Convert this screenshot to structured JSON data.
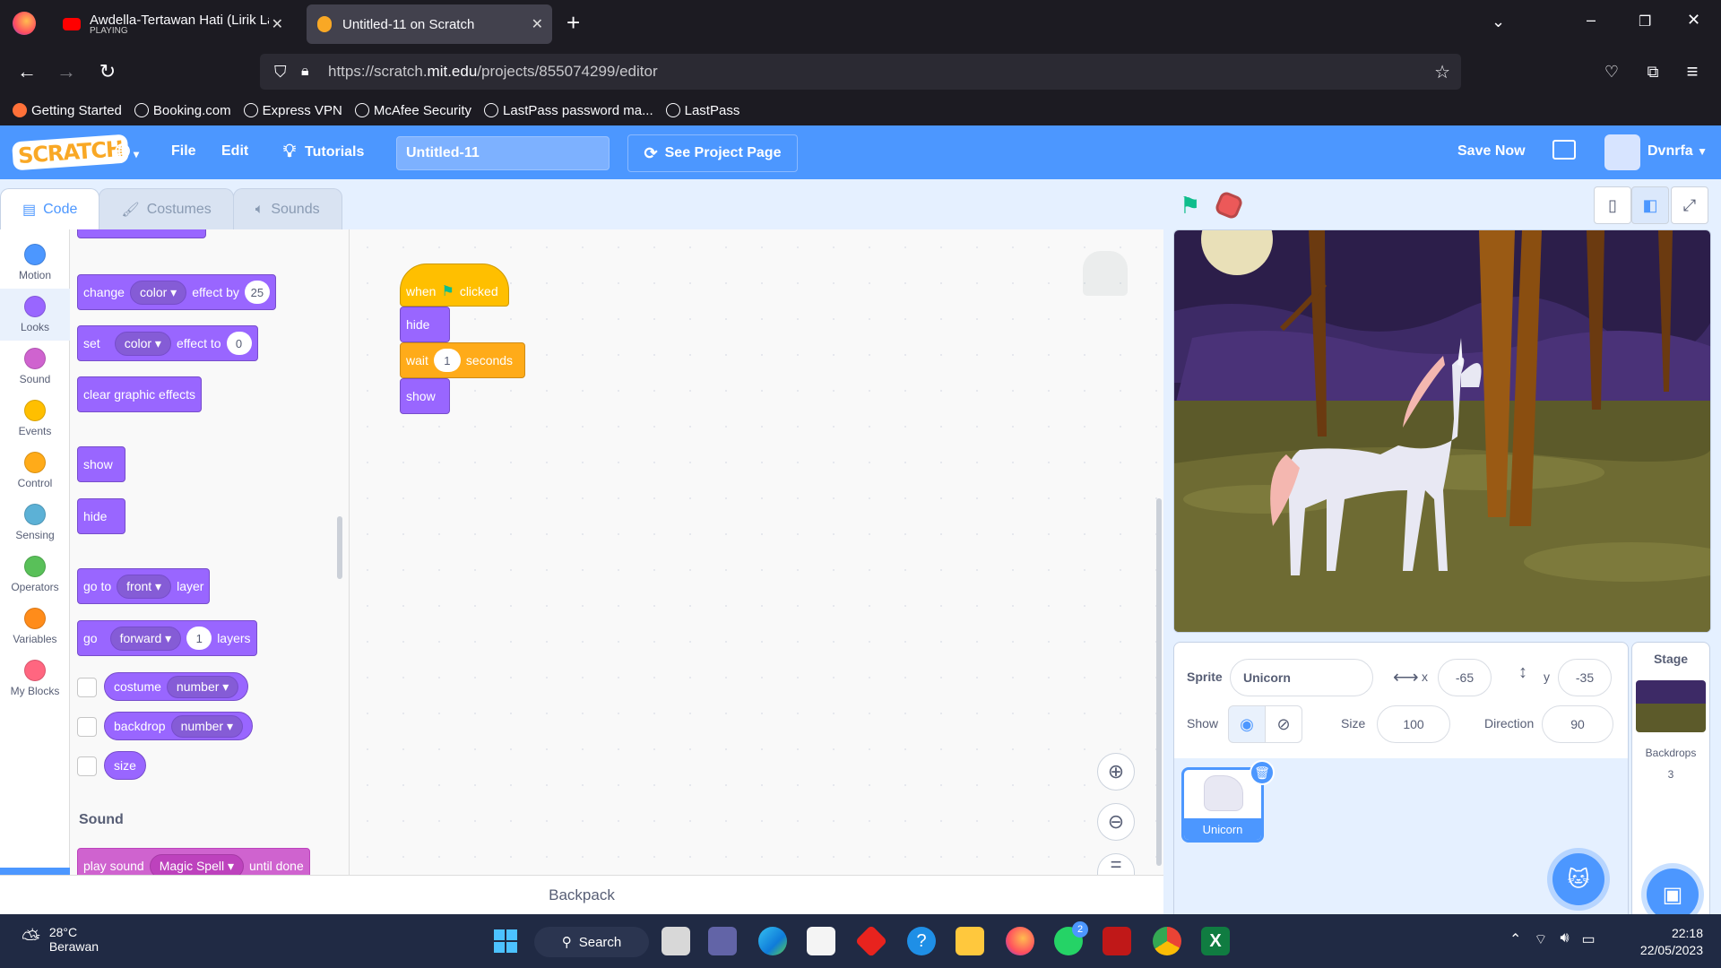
{
  "browser": {
    "tabs": [
      {
        "title": "Awdella-Tertawan Hati (Lirik La",
        "sub": "PLAYING"
      },
      {
        "title": "Untitled-11 on Scratch"
      }
    ],
    "url_prefix": "https://scratch.",
    "url_host": "mit.edu",
    "url_path": "/projects/855074299/editor",
    "bookmarks": [
      "Getting Started",
      "Booking.com",
      "Express VPN",
      "McAfee Security",
      "LastPass password ma...",
      "LastPass"
    ]
  },
  "menubar": {
    "logo": "SCRATCH",
    "file": "File",
    "edit": "Edit",
    "tutorials": "Tutorials",
    "project_title": "Untitled-11",
    "see_project": "See Project Page",
    "save_now": "Save Now",
    "username": "Dvnrfa"
  },
  "editor_tabs": [
    "Code",
    "Costumes",
    "Sounds"
  ],
  "categories": [
    {
      "label": "Motion",
      "color": "#4c97ff"
    },
    {
      "label": "Looks",
      "color": "#9966ff"
    },
    {
      "label": "Sound",
      "color": "#cf63cf"
    },
    {
      "label": "Events",
      "color": "#ffbf00"
    },
    {
      "label": "Control",
      "color": "#ffab19"
    },
    {
      "label": "Sensing",
      "color": "#5cb1d6"
    },
    {
      "label": "Operators",
      "color": "#59c059"
    },
    {
      "label": "Variables",
      "color": "#ff8c1a"
    },
    {
      "label": "My Blocks",
      "color": "#ff6680"
    }
  ],
  "palette": {
    "change_effect": {
      "a": "change",
      "dd": "color",
      "b": "effect by",
      "val": "25"
    },
    "set_effect": {
      "a": "set",
      "dd": "color",
      "b": "effect to",
      "val": "0"
    },
    "clear": "clear graphic effects",
    "show": "show",
    "hide": "hide",
    "goto_layer": {
      "a": "go to",
      "dd": "front",
      "b": "layer"
    },
    "go_layers": {
      "a": "go",
      "dd": "forward",
      "val": "1",
      "b": "layers"
    },
    "costume": {
      "a": "costume",
      "dd": "number"
    },
    "backdrop": {
      "a": "backdrop",
      "dd": "number"
    },
    "size": "size",
    "sound_title": "Sound",
    "play_sound": {
      "a": "play sound",
      "dd": "Magic Spell",
      "b": "until done"
    }
  },
  "script": {
    "when": "when",
    "clicked": "clicked",
    "hide": "hide",
    "wait": "wait",
    "wait_val": "1",
    "seconds": "seconds",
    "show": "show"
  },
  "backpack": "Backpack",
  "sprite_info": {
    "sprite_label": "Sprite",
    "sprite_name": "Unicorn",
    "x_label": "x",
    "x": "-65",
    "y_label": "y",
    "y": "-35",
    "show_label": "Show",
    "size_label": "Size",
    "size": "100",
    "direction_label": "Direction",
    "direction": "90"
  },
  "sprites": [
    {
      "name": "Unicorn"
    }
  ],
  "stage_pane": {
    "title": "Stage",
    "backdrops_label": "Backdrops",
    "backdrops_count": "3"
  },
  "taskbar": {
    "temp": "28°C",
    "weather": "Berawan",
    "search": "Search",
    "time": "22:18",
    "date": "22/05/2023",
    "whatsapp_badge": "2"
  },
  "colors": {
    "scratch_blue": "#4c97ff",
    "looks": "#9966ff",
    "events": "#ffbf00",
    "control": "#ffab19"
  }
}
